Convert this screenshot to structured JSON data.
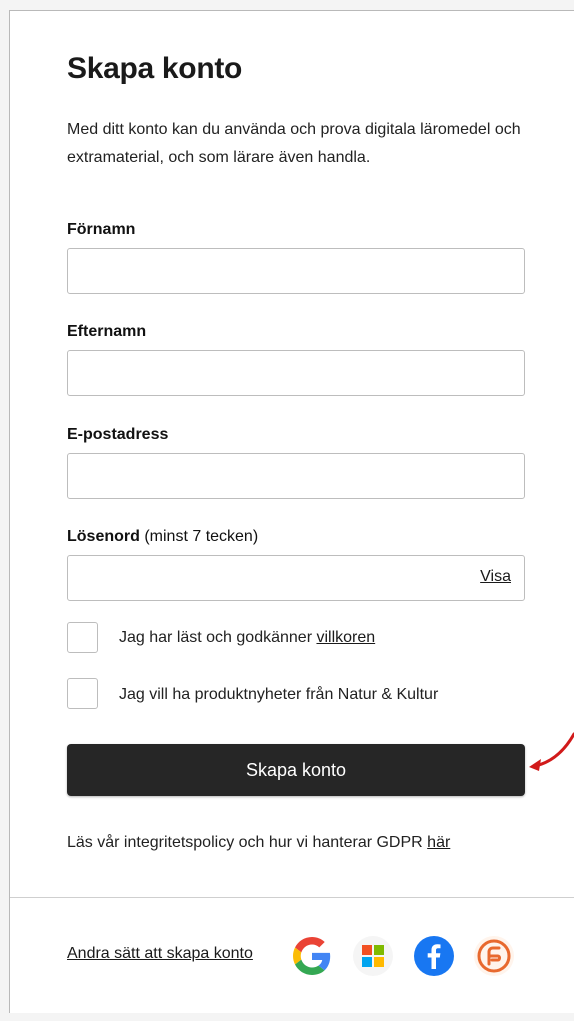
{
  "form": {
    "title": "Skapa konto",
    "intro": "Med ditt konto kan du använda och prova digitala läromedel och extramaterial, och som lärare även handla.",
    "fields": {
      "first_name_label": "Förnamn",
      "last_name_label": "Efternamn",
      "email_label": "E-postadress",
      "password_label": "Lösenord",
      "password_hint": "(minst 7 tecken)",
      "password_show": "Visa"
    },
    "checkboxes": {
      "terms_text": "Jag har läst och godkänner",
      "terms_link": "villkoren",
      "newsletter_text": "Jag vill ha produktnyheter från Natur & Kultur"
    },
    "submit_label": "Skapa konto",
    "gdpr_text": "Läs vår integritetspolicy och hur vi hanterar GDPR",
    "gdpr_link": "här"
  },
  "footer": {
    "alt_signup_label": "Andra sätt att skapa konto",
    "providers": [
      {
        "icon": "google-icon",
        "color": "#4285F4"
      },
      {
        "icon": "microsoft-icon",
        "color": "#F25022"
      },
      {
        "icon": "facebook-icon",
        "color": "#1877F2"
      },
      {
        "icon": "skolfederation-icon",
        "color": "#E8692E"
      }
    ]
  },
  "colors": {
    "button_bg": "#262626",
    "annotation_arrow": "#D11A1A"
  }
}
